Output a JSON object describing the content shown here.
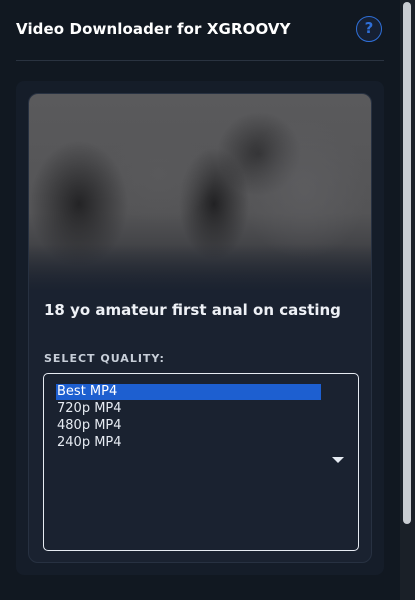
{
  "header": {
    "title": "Video Downloader for XGROOVY",
    "help_label": "?"
  },
  "video": {
    "title": "18 yo amateur first anal on casting"
  },
  "quality": {
    "label": "SELECT QUALITY:",
    "options": [
      "Best MP4",
      "720p MP4",
      "480p MP4",
      "240p MP4"
    ],
    "selected_index": 0
  },
  "colors": {
    "background": "#111821",
    "accent": "#2f6fd8",
    "selected_option": "#1d5fd0"
  }
}
